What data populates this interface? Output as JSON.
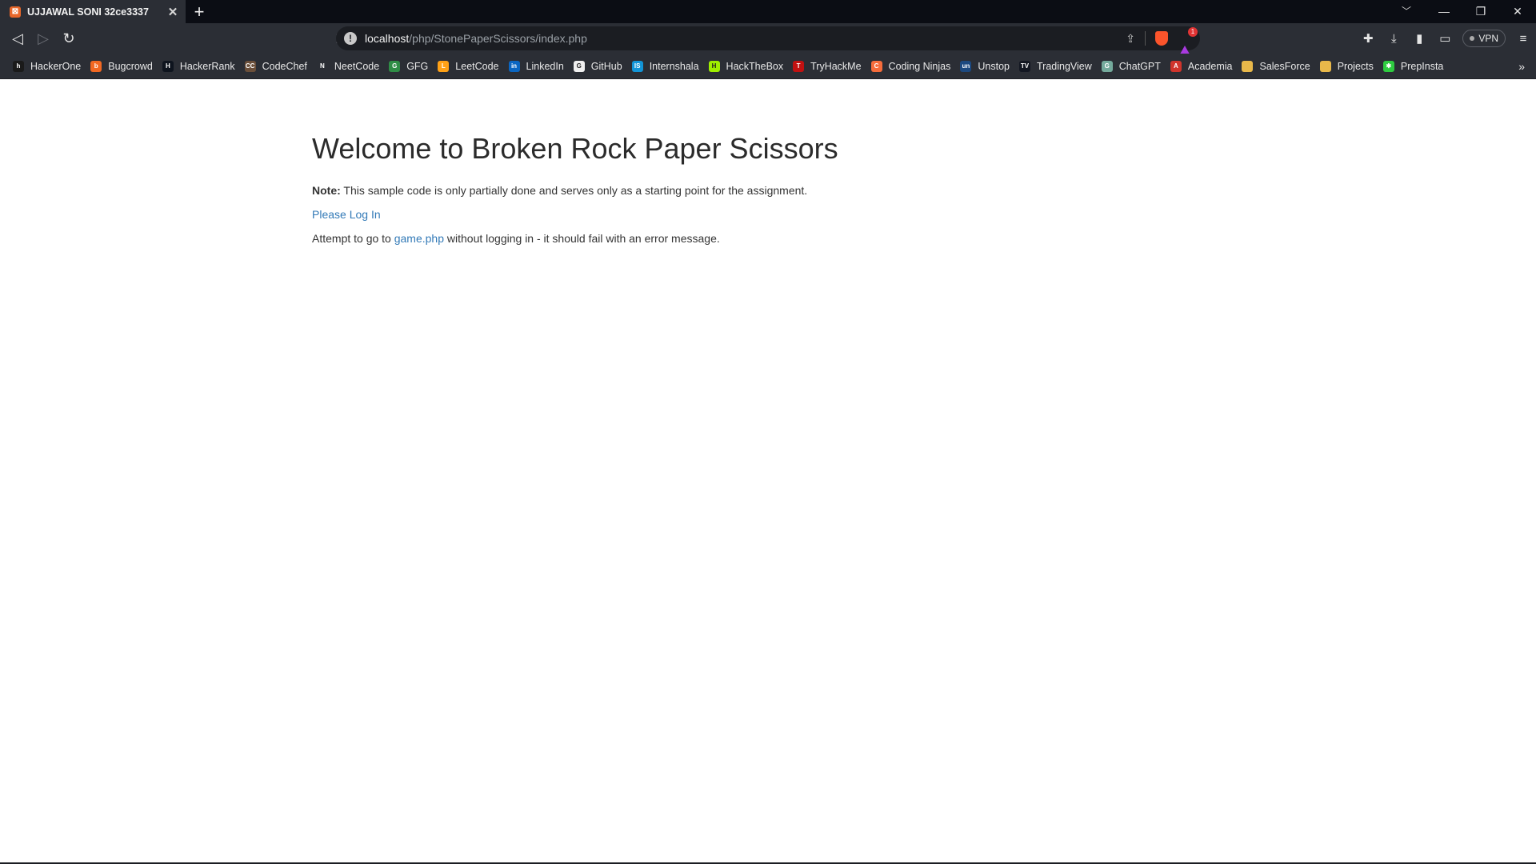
{
  "browser": {
    "tab": {
      "title": "UJJAWAL SONI 32ce3337",
      "close": "✕"
    },
    "new_tab": "+",
    "url_host": "localhost",
    "url_path": "/php/StonePaperScissors/index.php",
    "vpn_label": "VPN",
    "rewards_count": "1"
  },
  "bookmarks": [
    {
      "label": "HackerOne",
      "icon": "h",
      "color": "#1a1a1a"
    },
    {
      "label": "Bugcrowd",
      "icon": "b",
      "color": "#f26822"
    },
    {
      "label": "HackerRank",
      "icon": "H",
      "color": "#0e141e"
    },
    {
      "label": "CodeChef",
      "icon": "CC",
      "color": "#6b4f3a"
    },
    {
      "label": "NeetCode",
      "icon": "N",
      "color": "#2b2e35"
    },
    {
      "label": "GFG",
      "icon": "G",
      "color": "#2f8d46"
    },
    {
      "label": "LeetCode",
      "icon": "L",
      "color": "#ffa116"
    },
    {
      "label": "LinkedIn",
      "icon": "in",
      "color": "#0a66c2"
    },
    {
      "label": "GitHub",
      "icon": "G",
      "color": "#f0f0f0"
    },
    {
      "label": "Internshala",
      "icon": "IS",
      "color": "#1295d8"
    },
    {
      "label": "HackTheBox",
      "icon": "H",
      "color": "#9fef00"
    },
    {
      "label": "TryHackMe",
      "icon": "T",
      "color": "#c11111"
    },
    {
      "label": "Coding Ninjas",
      "icon": "C",
      "color": "#f66c3b"
    },
    {
      "label": "Unstop",
      "icon": "un",
      "color": "#1c4980"
    },
    {
      "label": "TradingView",
      "icon": "TV",
      "color": "#131722"
    },
    {
      "label": "ChatGPT",
      "icon": "G",
      "color": "#74aa9c"
    },
    {
      "label": "Academia",
      "icon": "A",
      "color": "#d0342c"
    },
    {
      "label": "SalesForce",
      "icon": "",
      "color": "#e8b84a"
    },
    {
      "label": "Projects",
      "icon": "",
      "color": "#e8b84a"
    },
    {
      "label": "PrepInsta",
      "icon": "✱",
      "color": "#2ecc40"
    }
  ],
  "page": {
    "heading": "Welcome to Broken Rock Paper Scissors",
    "note_label": "Note:",
    "note_text": " This sample code is only partially done and serves only as a starting point for the assignment.",
    "login_link": "Please Log In",
    "attempt_prefix": "Attempt to go to ",
    "game_link": "game.php",
    "attempt_suffix": " without logging in - it should fail with an error message."
  }
}
